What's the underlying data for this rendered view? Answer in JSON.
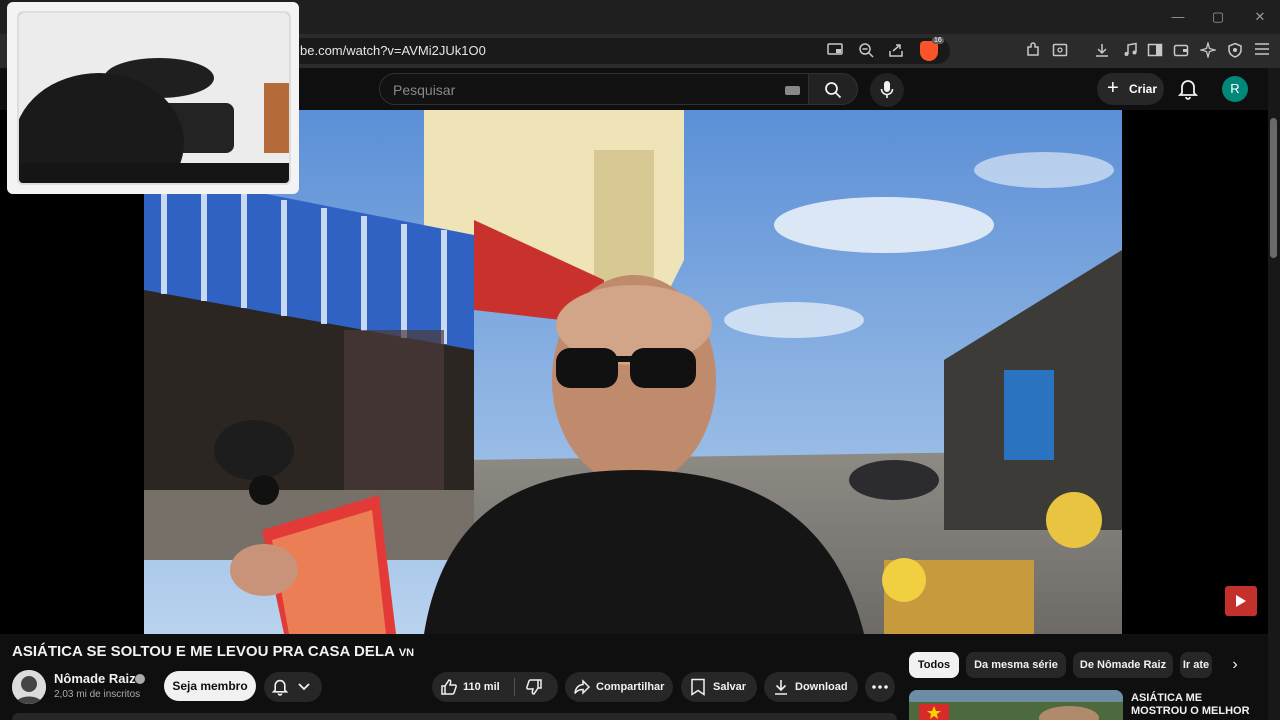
{
  "browser": {
    "url": "be.com/watch?v=AVMi2JUk1O0",
    "brave_badge": "16",
    "window_controls": {
      "minimize": "—",
      "maximize": "▢",
      "close": "✕"
    }
  },
  "youtube_header": {
    "search_placeholder": "Pesquisar",
    "create_label": "Criar",
    "avatar_letter": "R"
  },
  "video": {
    "title": "ASIÁTICA SE SOLTOU E ME LEVOU PRA CASA DELA",
    "title_suffix": "VN"
  },
  "channel": {
    "name": "Nômade Raiz",
    "subscribers": "2,03 mi de inscritos",
    "join_label": "Seja membro"
  },
  "actions": {
    "likes": "110 mil",
    "share_label": "Compartilhar",
    "save_label": "Salvar",
    "download_label": "Download"
  },
  "chips": [
    "Todos",
    "Da mesma série",
    "De Nômade Raiz",
    "Ir ate"
  ],
  "recommendation": {
    "title": "ASIÁTICA ME MOSTROU O MELHOR"
  },
  "colors": {
    "avatar_bg": "#00897b",
    "brave": "#fb542b",
    "youtube_red": "#c4302b"
  }
}
